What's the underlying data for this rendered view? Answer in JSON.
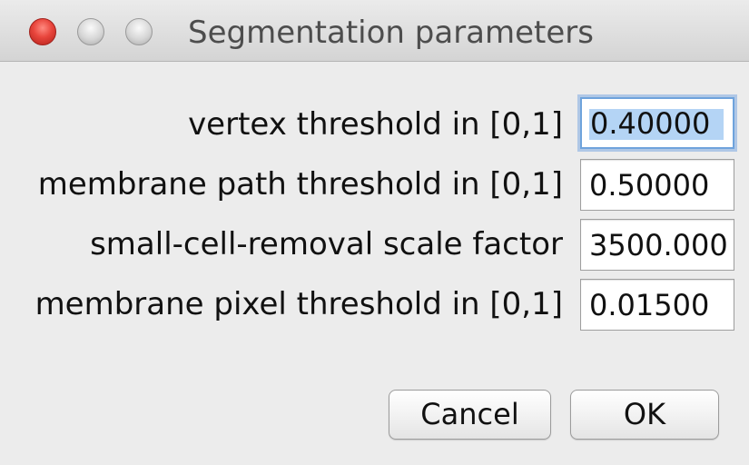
{
  "window": {
    "title": "Segmentation parameters"
  },
  "titlebar_buttons": {
    "close_icon": "close-icon",
    "minimize_icon": "minimize-icon",
    "zoom_icon": "zoom-icon"
  },
  "parameters": [
    {
      "label": "vertex threshold in [0,1]",
      "value": "0.40000",
      "focused": true
    },
    {
      "label": "membrane path threshold in [0,1]",
      "value": "0.50000",
      "focused": false
    },
    {
      "label": "small-cell-removal scale factor",
      "value": "3500.000",
      "focused": false
    },
    {
      "label": "membrane pixel threshold in [0,1]",
      "value": "0.01500",
      "focused": false
    }
  ],
  "buttons": {
    "cancel_label": "Cancel",
    "ok_label": "OK"
  },
  "colors": {
    "close_button": "#e8453c",
    "focus_ring": "#6fa3dc",
    "selection": "#b4d4f5",
    "dialog_background": "#ececec"
  }
}
